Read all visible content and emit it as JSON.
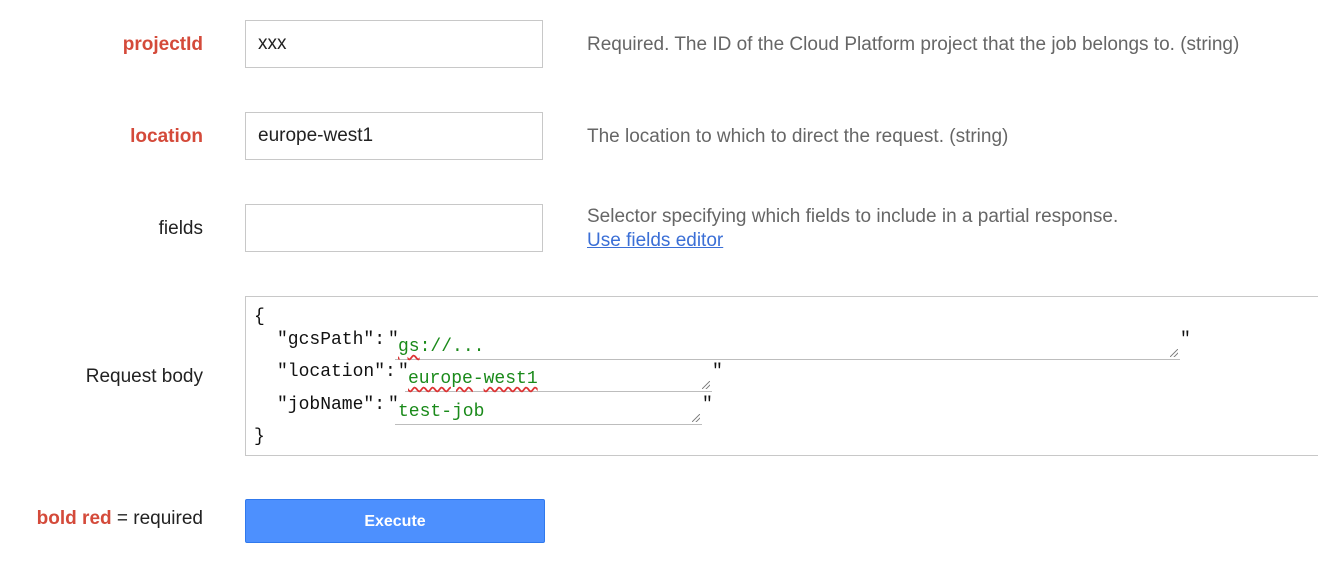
{
  "params": {
    "projectId": {
      "label": "projectId",
      "value": "xxx",
      "description": "Required. The ID of the Cloud Platform project that the job belongs to. (string)"
    },
    "location": {
      "label": "location",
      "value": "europe-west1",
      "description": "The location to which to direct the request. (string)"
    },
    "fields": {
      "label": "fields",
      "value": "",
      "description": "Selector specifying which fields to include in a partial response.",
      "link": "Use fields editor"
    }
  },
  "request_body": {
    "label": "Request body",
    "open_brace": "{",
    "close_brace": "}",
    "quote": "\"",
    "entries": [
      {
        "key": "\"gcsPath\":",
        "value_prefix": "gs",
        "value_rest": "://..."
      },
      {
        "key": "\"location\":",
        "value_word1": "europe",
        "value_dash": "-",
        "value_word2": "west1"
      },
      {
        "key": "\"jobName\":",
        "value": "test-job"
      }
    ]
  },
  "execute": {
    "label": "Execute"
  },
  "legend": {
    "bold_red": "bold red",
    "rest": " = required"
  },
  "colors": {
    "required": "#d44a3a",
    "button": "#4d90fe",
    "link": "#3b6fd6",
    "json_value": "#1a8a1a"
  }
}
